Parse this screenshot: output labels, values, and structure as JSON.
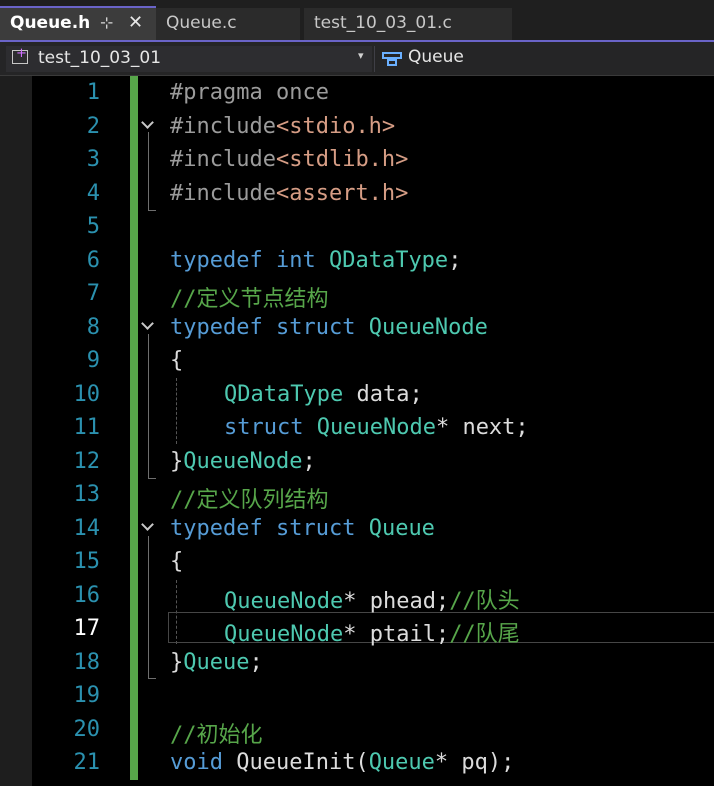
{
  "tabs": [
    {
      "label": "Queue.h",
      "active": true,
      "pin": "⊹",
      "close": "✕"
    },
    {
      "label": "Queue.c",
      "active": false
    },
    {
      "label": "test_10_03_01.c",
      "active": false
    }
  ],
  "nav": {
    "project": "test_10_03_01",
    "dropdown": "▾",
    "scope": "Queue"
  },
  "colors": {
    "keyword": "#569cd6",
    "type": "#4ec9b0",
    "include": "#d69d85",
    "comment": "#57a64a",
    "preprocessor": "#9b9b9b",
    "line_number": "#2b91af",
    "change_bar": "#57a64a",
    "tab_accent": "#6a64c8"
  },
  "current_line": 17,
  "lines": [
    {
      "num": "1",
      "t": [
        [
          "pp",
          "#pragma once"
        ]
      ]
    },
    {
      "num": "2",
      "t": [
        [
          "pp",
          "#include"
        ],
        [
          "inc",
          "<stdio.h>"
        ]
      ]
    },
    {
      "num": "3",
      "t": [
        [
          "pp",
          "#include"
        ],
        [
          "inc",
          "<stdlib.h>"
        ]
      ]
    },
    {
      "num": "4",
      "t": [
        [
          "pp",
          "#include"
        ],
        [
          "inc",
          "<assert.h>"
        ]
      ]
    },
    {
      "num": "5",
      "t": []
    },
    {
      "num": "6",
      "t": [
        [
          "kw",
          "typedef"
        ],
        [
          "pl",
          " "
        ],
        [
          "kw",
          "int"
        ],
        [
          "pl",
          " "
        ],
        [
          "ty",
          "QDataType"
        ],
        [
          "pl",
          ";"
        ]
      ]
    },
    {
      "num": "7",
      "t": [
        [
          "cm",
          "//定义节点结构"
        ]
      ]
    },
    {
      "num": "8",
      "t": [
        [
          "kw",
          "typedef"
        ],
        [
          "pl",
          " "
        ],
        [
          "kw",
          "struct"
        ],
        [
          "pl",
          " "
        ],
        [
          "ty",
          "QueueNode"
        ]
      ]
    },
    {
      "num": "9",
      "t": [
        [
          "pl",
          "{"
        ]
      ]
    },
    {
      "num": "10",
      "indent": true,
      "t": [
        [
          "ty",
          "QDataType"
        ],
        [
          "pl",
          " data;"
        ]
      ]
    },
    {
      "num": "11",
      "indent": true,
      "t": [
        [
          "kw",
          "struct"
        ],
        [
          "pl",
          " "
        ],
        [
          "ty",
          "QueueNode"
        ],
        [
          "pl",
          "* next;"
        ]
      ]
    },
    {
      "num": "12",
      "t": [
        [
          "pl",
          "}"
        ],
        [
          "ty",
          "QueueNode"
        ],
        [
          "pl",
          ";"
        ]
      ]
    },
    {
      "num": "13",
      "t": [
        [
          "cm",
          "//定义队列结构"
        ]
      ]
    },
    {
      "num": "14",
      "t": [
        [
          "kw",
          "typedef"
        ],
        [
          "pl",
          " "
        ],
        [
          "kw",
          "struct"
        ],
        [
          "pl",
          " "
        ],
        [
          "ty",
          "Queue"
        ]
      ]
    },
    {
      "num": "15",
      "t": [
        [
          "pl",
          "{"
        ]
      ]
    },
    {
      "num": "16",
      "indent": true,
      "t": [
        [
          "ty",
          "QueueNode"
        ],
        [
          "pl",
          "* phead;"
        ],
        [
          "cm",
          "//队头"
        ]
      ]
    },
    {
      "num": "17",
      "indent": true,
      "t": [
        [
          "ty",
          "QueueNode"
        ],
        [
          "pl",
          "* ptail;"
        ],
        [
          "cm",
          "//队尾"
        ]
      ]
    },
    {
      "num": "18",
      "t": [
        [
          "pl",
          "}"
        ],
        [
          "ty",
          "Queue"
        ],
        [
          "pl",
          ";"
        ]
      ]
    },
    {
      "num": "19",
      "t": []
    },
    {
      "num": "20",
      "t": [
        [
          "cm",
          "//初始化"
        ]
      ]
    },
    {
      "num": "21",
      "t": [
        [
          "kw",
          "void"
        ],
        [
          "pl",
          " QueueInit("
        ],
        [
          "ty",
          "Queue"
        ],
        [
          "pl",
          "* pq);"
        ]
      ]
    }
  ]
}
